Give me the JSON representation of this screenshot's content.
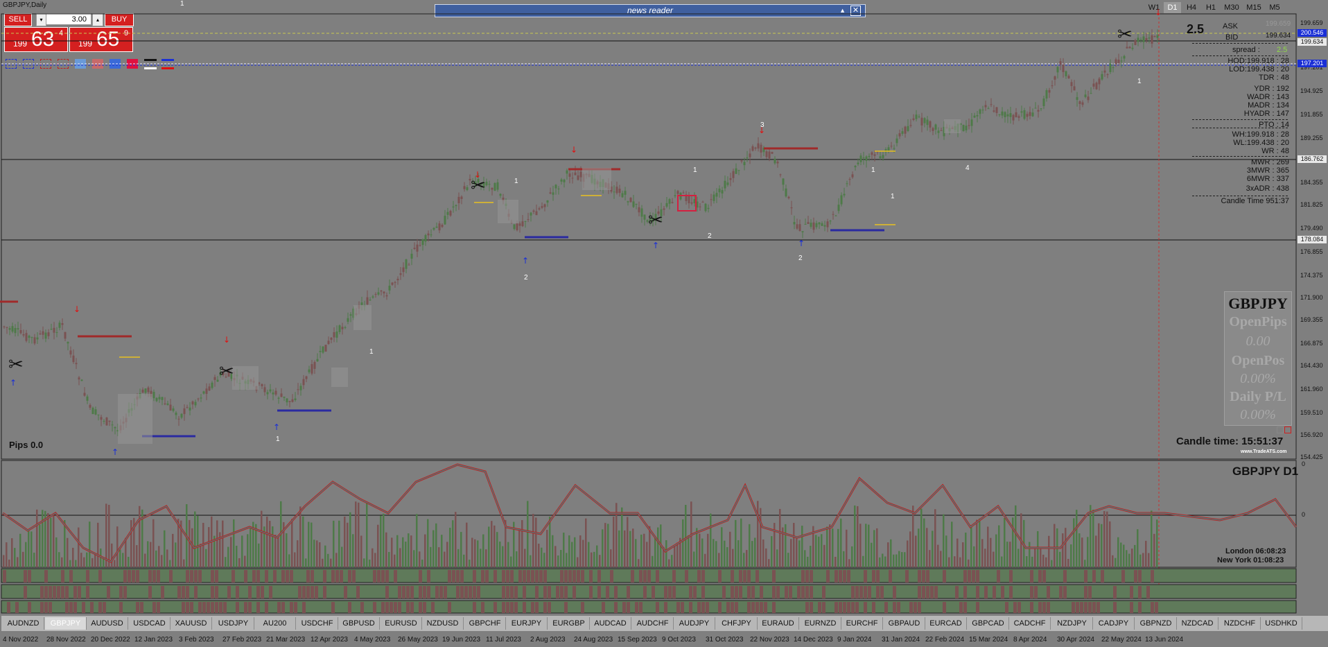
{
  "window": {
    "title": "GBPJPY,Daily"
  },
  "trade": {
    "sell_label": "SELL",
    "buy_label": "BUY",
    "lot": "3.00",
    "sell_small": "199",
    "sell_big": "63",
    "sell_sup": "4",
    "buy_small": "199",
    "buy_big": "65",
    "buy_sup": "9",
    "lot_arrow": "▾",
    "spin_arrow": "▴"
  },
  "news": {
    "label": "news reader",
    "collapse": "▲",
    "close": "✕"
  },
  "timeframes": [
    "W1",
    "D1",
    "H4",
    "H1",
    "M30",
    "M15",
    "M5"
  ],
  "active_timeframe": "D1",
  "spread_big": "2.5",
  "stats": {
    "ask_label": "ASK",
    "ask_value": "199.659",
    "bid_label": "BID",
    "bid_value": "199.634",
    "spread_label": "spread :",
    "spread_value": "2.5",
    "rows": [
      "HOD:199.918 :      28",
      "LOD:199.438 :      20",
      "TDR :      48",
      "YDR :     192",
      "WADR :     143",
      "MADR :     134",
      "HYADR :     147",
      "PTO :      14",
      "WH:199.918 :      28",
      "WL:199.438 :      20",
      "WR :      48",
      "MWR :     269",
      "3MWR :     365",
      "6MWR :     337",
      "3xADR :     438",
      "Candle Time   951:37"
    ]
  },
  "price_axis": [
    "199.659",
    "197.201",
    "194.925",
    "191.855",
    "189.255",
    "186.762",
    "184.355",
    "181.825",
    "179.490",
    "178.084",
    "176.855",
    "174.375",
    "171.900",
    "169.355",
    "166.875",
    "164.430",
    "161.960",
    "159.510",
    "156.920",
    "154.425"
  ],
  "price_tags": [
    {
      "value": "200.546",
      "bg": "#1a2fd6",
      "fg": "#ffffff"
    },
    {
      "value": "199.634",
      "bg": "#e8e8e8",
      "fg": "#111111"
    },
    {
      "value": "197.201",
      "bg": "#1a2fd6",
      "fg": "#ffffff"
    },
    {
      "value": "186.762",
      "bg": "#e8e8e8",
      "fg": "#111111"
    },
    {
      "value": "178.084",
      "bg": "#e8e8e8",
      "fg": "#111111"
    }
  ],
  "info_box": {
    "symbol": "GBPJPY",
    "open_pips_label": "OpenPips",
    "open_pips": "0.00",
    "open_pos_label": "OpenPos",
    "open_pos": "0.00%",
    "daily_label": "Daily P/L",
    "daily": "0.00%"
  },
  "pips": "Pips 0.0",
  "candle_time": "Candle time:  15:51:37",
  "brand": "www.TradeATS.com",
  "swing_labels": [
    "1",
    "1",
    "1",
    "1",
    "2",
    "1",
    "2",
    "3",
    "2",
    "1",
    "4",
    "1",
    "1",
    "1"
  ],
  "sub": {
    "title": "GBPJPY  D1",
    "london": "London     06:08:23",
    "newyork": "New York    01:08:23",
    "axis_top": "0",
    "axis_mid": "0"
  },
  "tabs": [
    "AUDNZD",
    "GBPJPY",
    "AUDUSD",
    "USDCAD",
    "XAUUSD",
    "USDJPY",
    "AU200",
    "USDCHF",
    "GBPUSD",
    "EURUSD",
    "NZDUSD",
    "GBPCHF",
    "EURJPY",
    "EURGBP",
    "AUDCAD",
    "AUDCHF",
    "AUDJPY",
    "CHFJPY",
    "EURAUD",
    "EURNZD",
    "EURCHF",
    "GBPAUD",
    "EURCAD",
    "GBPCAD",
    "CADCHF",
    "NZDJPY",
    "CADJPY",
    "GBPNZD",
    "NZDCAD",
    "NZDCHF",
    "USDHKD"
  ],
  "active_tab": "GBPJPY",
  "dates": [
    "4 Nov 2022",
    "28 Nov 2022",
    "20 Dec 2022",
    "12 Jan 2023",
    "3 Feb 2023",
    "27 Feb 2023",
    "21 Mar 2023",
    "12 Apr 2023",
    "4 May 2023",
    "26 May 2023",
    "19 Jun 2023",
    "11 Jul 2023",
    "2 Aug 2023",
    "24 Aug 2023",
    "15 Sep 2023",
    "9 Oct 2023",
    "31 Oct 2023",
    "22 Nov 2023",
    "14 Dec 2023",
    "9 Jan 2024",
    "31 Jan 2024",
    "22 Feb 2024",
    "15 Mar 2024",
    "8 Apr 2024",
    "30 Apr 2024",
    "22 May 2024",
    "13 Jun 2024"
  ],
  "colors": {
    "bull": "#4e7a48",
    "bear": "#7a5252",
    "osc": "#3a8a8a",
    "osc_red": "#c81818",
    "bg": "#7f7f7f"
  }
}
